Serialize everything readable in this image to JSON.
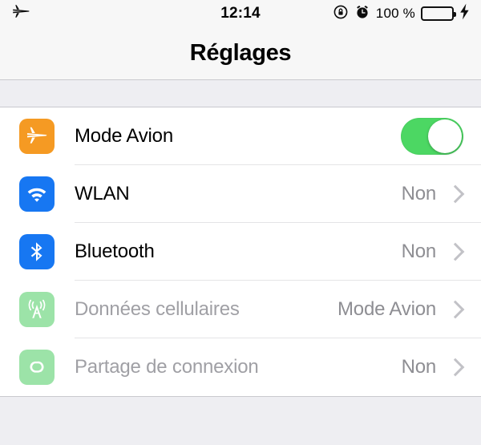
{
  "status_bar": {
    "airplane_icon": "airplane-icon",
    "time": "12:14",
    "rotation_lock_icon": "rotation-lock-icon",
    "alarm_icon": "alarm-clock-icon",
    "battery_percent": "100 %",
    "battery_level": 100,
    "charging_icon": "lightning-bolt-icon"
  },
  "nav": {
    "title": "Réglages"
  },
  "settings_group": {
    "rows": [
      {
        "label": "Mode Avion",
        "icon": "airplane-icon",
        "icon_color": "#F59A23",
        "control": "toggle",
        "toggle_on": true,
        "disabled": false
      },
      {
        "label": "WLAN",
        "icon": "wifi-icon",
        "icon_color": "#1777F2",
        "control": "value",
        "value": "Non",
        "disabled": false
      },
      {
        "label": "Bluetooth",
        "icon": "bluetooth-icon",
        "icon_color": "#1777F2",
        "control": "value",
        "value": "Non",
        "disabled": false
      },
      {
        "label": "Données cellulaires",
        "icon": "cellular-antenna-icon",
        "icon_color": "#9CE3A8",
        "control": "value",
        "value": "Mode Avion",
        "disabled": true
      },
      {
        "label": "Partage de connexion",
        "icon": "personal-hotspot-icon",
        "icon_color": "#9CE3A8",
        "control": "value",
        "value": "Non",
        "disabled": true
      }
    ]
  },
  "colors": {
    "accent_green": "#4CD763",
    "icon_orange": "#F59A23",
    "icon_blue": "#1777F2",
    "icon_green_faded": "#9CE3A8",
    "background": "#EEEEF2",
    "chrome": "#F7F7F7"
  }
}
